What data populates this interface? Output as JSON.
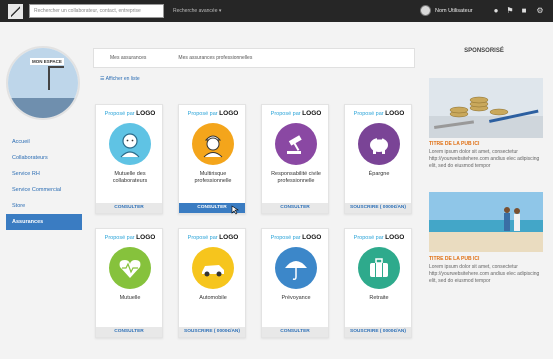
{
  "header": {
    "search_placeholder": "Rechercher un collaborateur, contact, entreprise",
    "advanced_search": "Recherche avancée ▾",
    "user_name": "Nom Utilisateur"
  },
  "sidebar": {
    "logo_text": "MON ESPACE",
    "items": [
      {
        "label": "Accueil"
      },
      {
        "label": "Collaborateurs"
      },
      {
        "label": "Service RH"
      },
      {
        "label": "Service Commercial"
      },
      {
        "label": "Store"
      },
      {
        "label": "Assurances"
      }
    ]
  },
  "tabs": [
    {
      "label": "Mes assurances"
    },
    {
      "label": "Mes assurances professionnelles"
    }
  ],
  "list_link": "Afficher en liste",
  "cards": [
    {
      "prefix": "Proposé par",
      "logo": "LOGO",
      "title": "Mutuelle des collaborateurs",
      "button": "CONSULTER",
      "color": "#5fc3e4",
      "icon": "doctor-icon"
    },
    {
      "prefix": "Proposé par",
      "logo": "LOGO",
      "title": "Multirisque professionnelle",
      "button": "CONSULTER",
      "color": "#f4a51b",
      "icon": "worker-icon"
    },
    {
      "prefix": "Proposé par",
      "logo": "LOGO",
      "title": "Responsabilité civile professionnelle",
      "button": "CONSULTER",
      "color": "#8a48a3",
      "icon": "gavel-icon"
    },
    {
      "prefix": "Proposé par",
      "logo": "LOGO",
      "title": "Épargne",
      "button": "SOUSCRIRE ( 0000€/AN)",
      "color": "#7a4496",
      "icon": "piggy-bank-icon"
    },
    {
      "prefix": "Proposé par",
      "logo": "LOGO",
      "title": "Mutuelle",
      "button": "CONSULTER",
      "color": "#86c23c",
      "icon": "heart-icon"
    },
    {
      "prefix": "Proposé par",
      "logo": "LOGO",
      "title": "Automobile",
      "button": "SOUSCRIRE ( 0000€/AN)",
      "color": "#f6c51d",
      "icon": "car-icon"
    },
    {
      "prefix": "Proposé par",
      "logo": "LOGO",
      "title": "Prévoyance",
      "button": "CONSULTER",
      "color": "#3c87c9",
      "icon": "umbrella-icon"
    },
    {
      "prefix": "Proposé par",
      "logo": "LOGO",
      "title": "Retraite",
      "button": "SOUSCRIRE ( 0000€/AN)",
      "color": "#2eaa8c",
      "icon": "suitcase-icon"
    }
  ],
  "sponsor": {
    "heading": "SPONSORISÉ",
    "ads": [
      {
        "title": "TITRE DE LA PUB ICI",
        "text": "Lorem ipsum dolor sit amet, consectetur http://yourwebsitehere.com andius elec adipiscing elit, sed do eiusmod tempor"
      },
      {
        "title": "TITRE DE LA PUB ICI",
        "text": "Lorem ipsum dolor sit amet, consectetur http://yourwebsitehere.com andius elec adipiscing elit, sed do eiusmod tempor"
      }
    ]
  }
}
